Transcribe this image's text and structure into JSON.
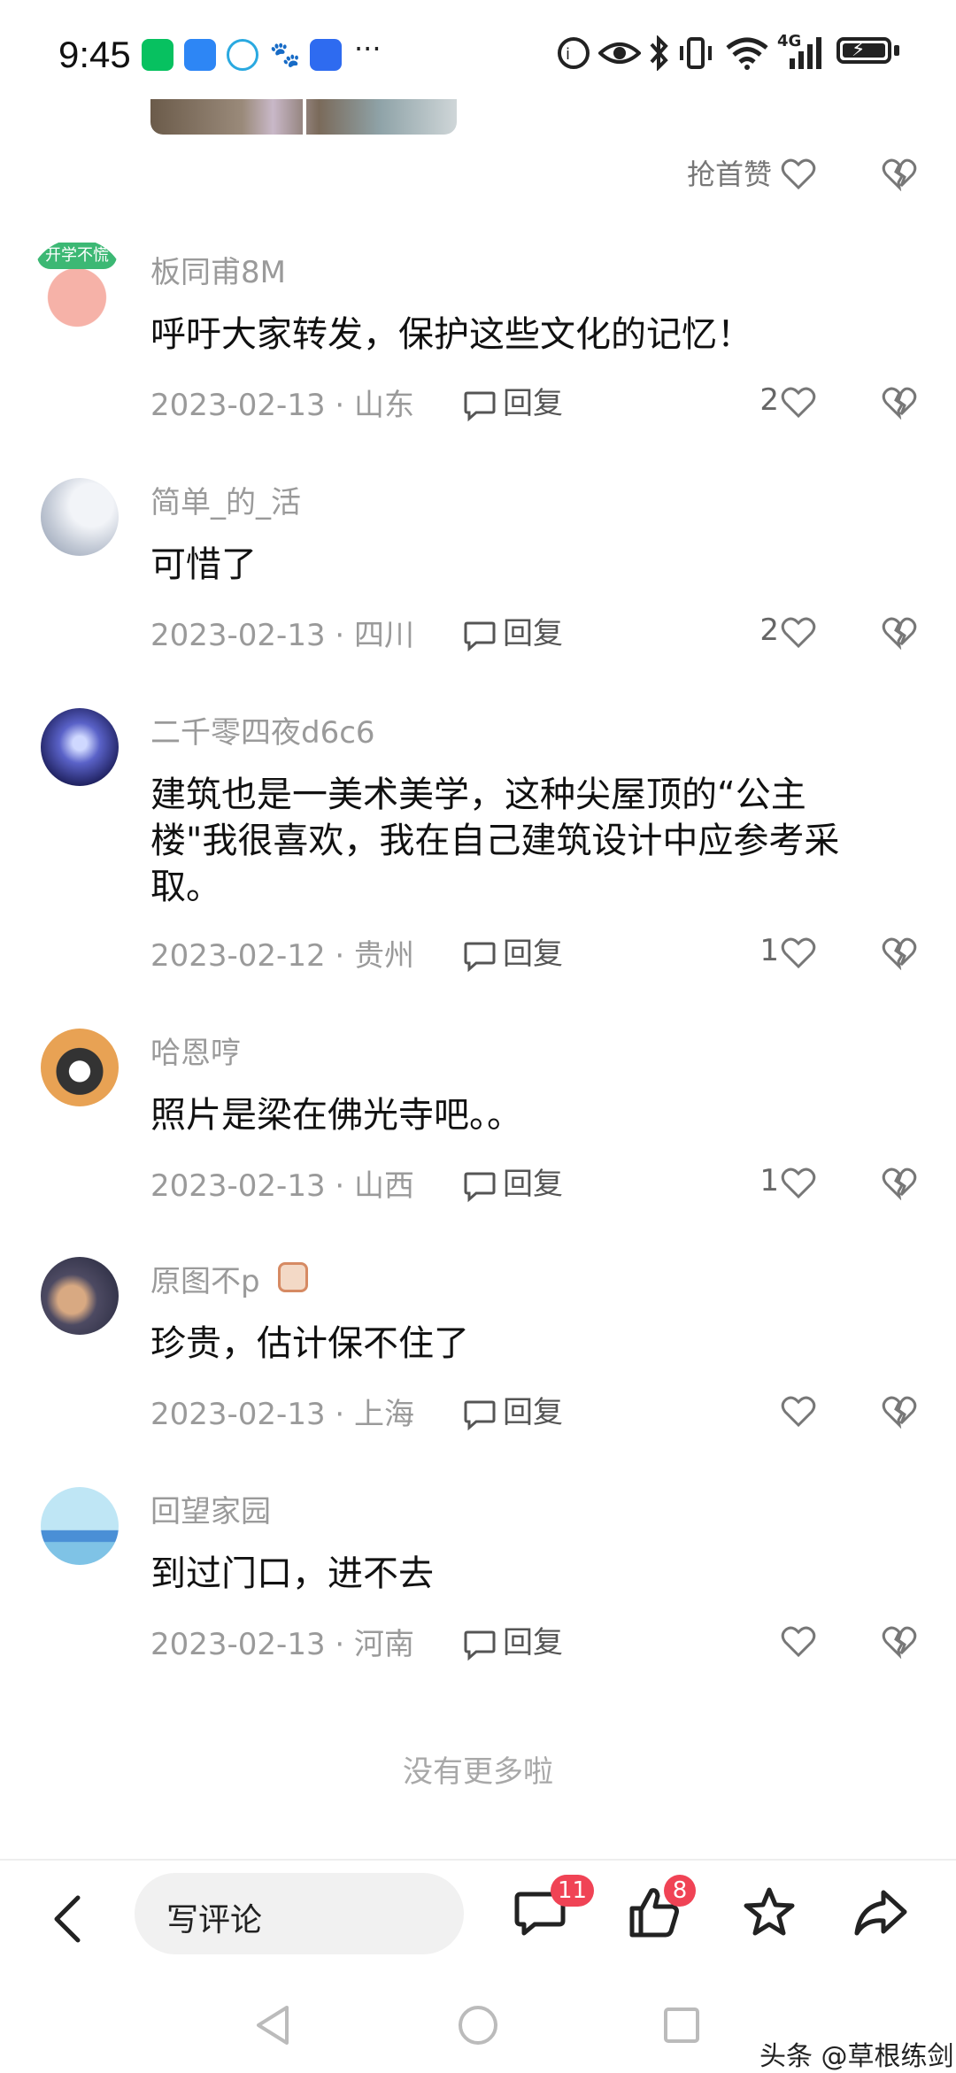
{
  "status_bar": {
    "time": "9:45",
    "apps": [
      "wechat-icon",
      "app-icon",
      "browser-icon",
      "baidu-icon",
      "shield-app-icon"
    ],
    "more": "···",
    "network": "4G"
  },
  "top_post": {
    "first_like_label": "抢首赞"
  },
  "comments": [
    {
      "username": "板同甫8M",
      "content": "呼吁大家转发，保护这些文化的记忆！",
      "meta": "2023-02-13 · 山东",
      "reply": "回复",
      "likes": "2"
    },
    {
      "username": "简单_的_活",
      "content": "可惜了",
      "meta": "2023-02-13 · 四川",
      "reply": "回复",
      "likes": "2"
    },
    {
      "username": "二千零四夜d6c6",
      "content": "建筑也是一美术美学，这种尖屋顶的“公主楼\"我很喜欢，我在自己建筑设计中应参考采取。",
      "meta": "2023-02-12 · 贵州",
      "reply": "回复",
      "likes": "1"
    },
    {
      "username": "哈恩哼",
      "content": "照片是梁在佛光寺吧。。",
      "meta": "2023-02-13 · 山西",
      "reply": "回复",
      "likes": "1"
    },
    {
      "username": "原图不p",
      "content": "珍贵，估计保不住了",
      "meta": "2023-02-13 · 上海",
      "reply": "回复",
      "likes": ""
    },
    {
      "username": "回望家园",
      "content": "到过门口，进不去",
      "meta": "2023-02-13 · 河南",
      "reply": "回复",
      "likes": ""
    }
  ],
  "footer_text": "没有更多啦",
  "bottom_bar": {
    "comment_placeholder": "写评论",
    "comment_count": "11",
    "like_count": "8"
  },
  "watermark": "头条 @草根练剑",
  "colors": {
    "badge_red": "#f04355",
    "text_gray": "#9a9a9a"
  }
}
